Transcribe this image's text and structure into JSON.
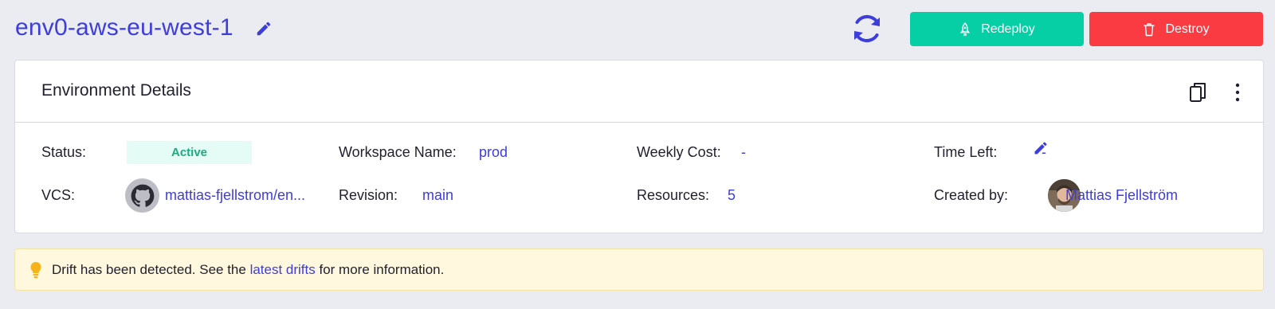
{
  "header": {
    "env_name": "env0-aws-eu-west-1",
    "redeploy_label": "Redeploy",
    "destroy_label": "Destroy"
  },
  "card": {
    "title": "Environment Details",
    "status": {
      "label": "Status:",
      "value": "Active"
    },
    "workspace": {
      "label": "Workspace Name:",
      "value": "prod"
    },
    "weekly_cost": {
      "label": "Weekly Cost:",
      "value": "-"
    },
    "time_left": {
      "label": "Time Left:",
      "value": "-"
    },
    "vcs": {
      "label": "VCS:",
      "value": "mattias-fjellstrom/en..."
    },
    "revision": {
      "label": "Revision:",
      "value": "main"
    },
    "resources": {
      "label": "Resources:",
      "value": "5"
    },
    "created_by": {
      "label": "Created by:",
      "value": "Mattias Fjellström"
    }
  },
  "alert": {
    "text_before": "Drift has been detected. See the ",
    "link": "latest drifts",
    "text_after": " for more information."
  },
  "icons": {
    "title_edit": "pencil-icon",
    "refresh": "refresh-icon",
    "redeploy": "rocket-icon",
    "destroy": "trash-icon",
    "copy": "copy-icon",
    "kebab": "more-vertical-icon",
    "github": "github-icon",
    "bulb": "lightbulb-icon"
  },
  "colors": {
    "accent": "#3d3ddb",
    "redeploy": "#06cfa5",
    "destroy": "#fb3b42",
    "active_text": "#1eaa80",
    "active_bg": "#e5fbf5",
    "alert_bg": "#fff8df",
    "bulb": "#f5b21b"
  }
}
